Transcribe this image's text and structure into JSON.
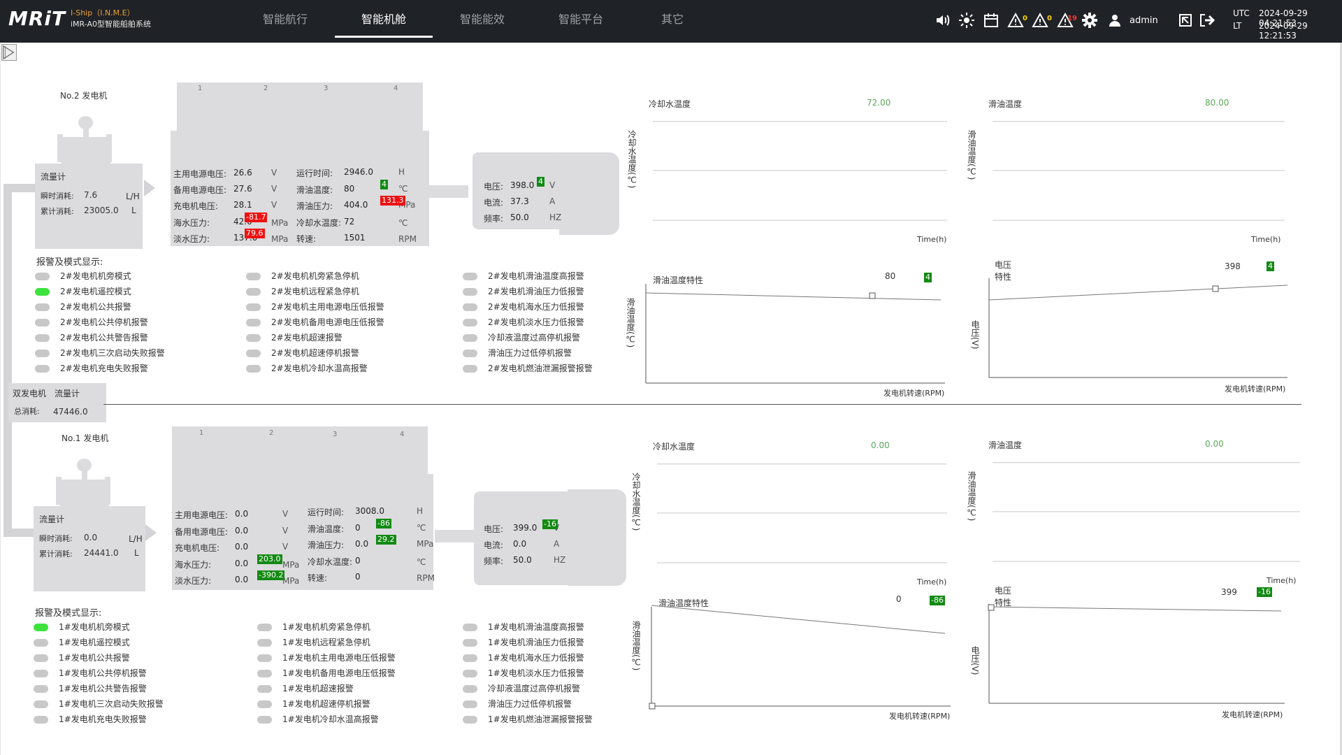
{
  "app": {
    "logo": "MRiT",
    "subtitle1": "I-Ship（I.N.M.E）",
    "subtitle2": "iMR-A0型智能船舶系统"
  },
  "nav": {
    "tabs": [
      "智能航行",
      "智能机舱",
      "智能能效",
      "智能平台",
      "其它"
    ],
    "active": "智能机舱"
  },
  "topbar": {
    "icons": [
      "speaker-icon",
      "brightness-icon",
      "calendar-icon",
      "warning-icon",
      "warning-icon",
      "warning-icon",
      "gear-icon",
      "user-icon",
      "exit-window-icon",
      "logout-icon"
    ],
    "warning_counts": [
      "0",
      "0",
      "19"
    ],
    "warning_colors": [
      "#ffd400",
      "#ffd400",
      "#ff3333"
    ],
    "user": "admin",
    "utc_label": "UTC",
    "lt_label": "LT",
    "utc_time": "2024-09-29 04:21:53",
    "lt_time": "2024-09-29 12:21:53"
  },
  "combined": {
    "title": "双发电机",
    "flow_label": "流量计",
    "total_label": "总消耗:",
    "total_value": "47446.0"
  },
  "gen2": {
    "title": "No.2 发电机",
    "cylinders": [
      "1",
      "2",
      "3",
      "4"
    ],
    "flowmeter": {
      "title": "流量计",
      "rate_label": "瞬时消耗:",
      "rate_value": "7.6",
      "rate_unit": "L/H",
      "total_label": "累计消耗:",
      "total_value": "23005.0",
      "total_unit": "L"
    },
    "params_left": [
      {
        "label": "主用电源电压:",
        "value": "26.6",
        "unit": "V",
        "badge": ""
      },
      {
        "label": "备用电源电压:",
        "value": "27.6",
        "unit": "V",
        "badge": ""
      },
      {
        "label": "充电机电压:",
        "value": "28.1",
        "unit": "V",
        "badge": ""
      },
      {
        "label": "海水压力:",
        "value": "42.0",
        "unit": "MPa",
        "badge": "-81.7"
      },
      {
        "label": "淡水压力:",
        "value": "137.0",
        "unit": "MPa",
        "badge": "79.6"
      }
    ],
    "params_right": [
      {
        "label": "运行时间:",
        "value": "2946.0",
        "unit": "H",
        "badge": ""
      },
      {
        "label": "滑油温度:",
        "value": "80",
        "unit": "℃",
        "badge": "4"
      },
      {
        "label": "滑油压力:",
        "value": "404.0",
        "unit": "MPa",
        "badge": "131.3"
      },
      {
        "label": "冷却水温度:",
        "value": "72",
        "unit": "℃",
        "badge": ""
      },
      {
        "label": "转速:",
        "value": "1501",
        "unit": "RPM",
        "badge": ""
      }
    ],
    "generator": [
      {
        "label": "电压:",
        "value": "398.0",
        "unit": "V",
        "badge": "4"
      },
      {
        "label": "电流:",
        "value": "37.3",
        "unit": "A",
        "badge": ""
      },
      {
        "label": "频率:",
        "value": "50.0",
        "unit": "HZ",
        "badge": ""
      }
    ],
    "alarm_title": "报警及模式显示:",
    "alarms_col1": [
      {
        "label": "2#发电机机旁模式",
        "on": false
      },
      {
        "label": "2#发电机遥控模式",
        "on": true
      },
      {
        "label": "2#发电机公共报警",
        "on": false
      },
      {
        "label": "2#发电机公共停机报警",
        "on": false
      },
      {
        "label": "2#发电机公共警告报警",
        "on": false
      },
      {
        "label": "2#发电机三次启动失败报警",
        "on": false
      },
      {
        "label": "2#发电机充电失败报警",
        "on": false
      }
    ],
    "alarms_col2": [
      {
        "label": "2#发电机机旁紧急停机",
        "on": false
      },
      {
        "label": "2#发电机远程紧急停机",
        "on": false
      },
      {
        "label": "2#发电机主用电源电压低报警",
        "on": false
      },
      {
        "label": "2#发电机备用电源电压低报警",
        "on": false
      },
      {
        "label": "2#发电机超速报警",
        "on": false
      },
      {
        "label": "2#发电机超速停机报警",
        "on": false
      },
      {
        "label": "2#发电机冷却水温高报警",
        "on": false
      }
    ],
    "alarms_col3": [
      {
        "label": "2#发电机滑油温度高报警",
        "on": false
      },
      {
        "label": "2#发电机滑油压力低报警",
        "on": false
      },
      {
        "label": "2#发电机海水压力低报警",
        "on": false
      },
      {
        "label": "2#发电机淡水压力低报警",
        "on": false
      },
      {
        "label": "冷却液温度过高停机报警",
        "on": false
      },
      {
        "label": "滑油压力过低停机报警",
        "on": false
      },
      {
        "label": "2#发电机燃油泄漏报警报警",
        "on": false
      }
    ],
    "chart_cool": {
      "title": "冷却水温度",
      "value": "72.00",
      "ylabel": "冷却水温度(℃)",
      "xlabel": "Time(h)"
    },
    "chart_oil": {
      "title": "滑油温度",
      "value": "80.00",
      "ylabel": "滑油温度(℃)",
      "xlabel": "Time(h)"
    },
    "chart_oilchar": {
      "title": "滑油温度特性",
      "num": "80",
      "badge": "4",
      "ylabel": "滑油温度(℃)",
      "xlabel": "发电机转速(RPM)"
    },
    "chart_volt": {
      "title1": "电压",
      "title2": "特性",
      "num": "398",
      "badge": "4",
      "ylabel": "电压(V)",
      "xlabel": "发电机转速(RPM)"
    }
  },
  "gen1": {
    "title": "No.1 发电机",
    "cylinders": [
      "1",
      "2",
      "3",
      "4"
    ],
    "flowmeter": {
      "title": "流量计",
      "rate_label": "瞬时消耗:",
      "rate_value": "0.0",
      "rate_unit": "L/H",
      "total_label": "累计消耗:",
      "total_value": "24441.0",
      "total_unit": "L"
    },
    "params_left": [
      {
        "label": "主用电源电压:",
        "value": "0.0",
        "unit": "V",
        "badge": ""
      },
      {
        "label": "备用电源电压:",
        "value": "0.0",
        "unit": "V",
        "badge": ""
      },
      {
        "label": "充电机电压:",
        "value": "0.0",
        "unit": "V",
        "badge": ""
      },
      {
        "label": "海水压力:",
        "value": "0.0",
        "unit": "MPa",
        "badge": "203.0"
      },
      {
        "label": "淡水压力:",
        "value": "0.0",
        "unit": "MPa",
        "badge": "-390.2"
      }
    ],
    "params_right": [
      {
        "label": "运行时间:",
        "value": "3008.0",
        "unit": "H",
        "badge": ""
      },
      {
        "label": "滑油温度:",
        "value": "0",
        "unit": "℃",
        "badge": "-86"
      },
      {
        "label": "滑油压力:",
        "value": "0.0",
        "unit": "MPa",
        "badge": "29.2"
      },
      {
        "label": "冷却水温度:",
        "value": "0",
        "unit": "℃",
        "badge": ""
      },
      {
        "label": "转速:",
        "value": "0",
        "unit": "RPM",
        "badge": ""
      }
    ],
    "generator": [
      {
        "label": "电压:",
        "value": "399.0",
        "unit": "V",
        "badge": "-16"
      },
      {
        "label": "电流:",
        "value": "0.0",
        "unit": "A",
        "badge": ""
      },
      {
        "label": "频率:",
        "value": "50.0",
        "unit": "HZ",
        "badge": ""
      }
    ],
    "alarm_title": "报警及模式显示:",
    "alarms_col1": [
      {
        "label": "1#发电机机旁模式",
        "on": true
      },
      {
        "label": "1#发电机遥控模式",
        "on": false
      },
      {
        "label": "1#发电机公共报警",
        "on": false
      },
      {
        "label": "1#发电机公共停机报警",
        "on": false
      },
      {
        "label": "1#发电机公共警告报警",
        "on": false
      },
      {
        "label": "1#发电机三次启动失败报警",
        "on": false
      },
      {
        "label": "1#发电机充电失败报警",
        "on": false
      }
    ],
    "alarms_col2": [
      {
        "label": "1#发电机机旁紧急停机",
        "on": false
      },
      {
        "label": "1#发电机远程紧急停机",
        "on": false
      },
      {
        "label": "1#发电机主用电源电压低报警",
        "on": false
      },
      {
        "label": "1#发电机备用电源电压低报警",
        "on": false
      },
      {
        "label": "1#发电机超速报警",
        "on": false
      },
      {
        "label": "1#发电机超速停机报警",
        "on": false
      },
      {
        "label": "1#发电机冷却水温高报警",
        "on": false
      }
    ],
    "alarms_col3": [
      {
        "label": "1#发电机滑油温度高报警",
        "on": false
      },
      {
        "label": "1#发电机滑油压力低报警",
        "on": false
      },
      {
        "label": "1#发电机海水压力低报警",
        "on": false
      },
      {
        "label": "1#发电机淡水压力低报警",
        "on": false
      },
      {
        "label": "冷却液温度过高停机报警",
        "on": false
      },
      {
        "label": "滑油压力过低停机报警",
        "on": false
      },
      {
        "label": "1#发电机燃油泄漏报警报警",
        "on": false
      }
    ],
    "chart_cool": {
      "title": "冷却水温度",
      "value": "0.00",
      "ylabel": "冷却水温度(℃)",
      "xlabel": "Time(h)"
    },
    "chart_oil": {
      "title": "滑油温度",
      "value": "0.00",
      "ylabel": "滑油温度(℃)",
      "xlabel": "Time(h)"
    },
    "chart_oilchar": {
      "title": "滑油温度特性",
      "num": "0",
      "badge": "-86",
      "ylabel": "滑油温度(℃)",
      "xlabel": "发电机转速(RPM)"
    },
    "chart_volt": {
      "title1": "电压",
      "title2": "特性",
      "num": "399",
      "badge": "-16",
      "ylabel": "电压(V)",
      "xlabel": "发电机转速(RPM)"
    }
  }
}
